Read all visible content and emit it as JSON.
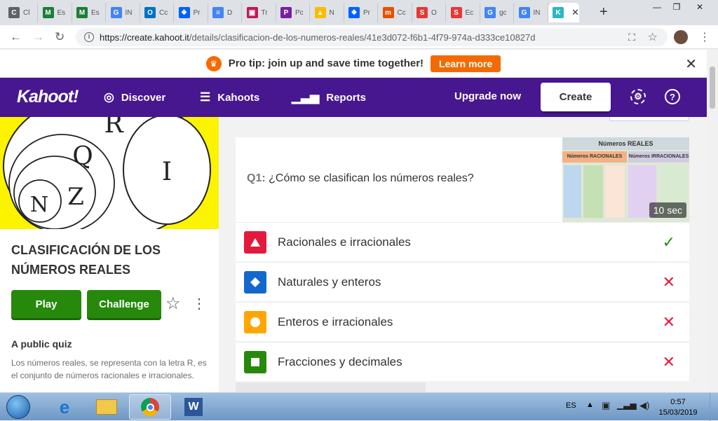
{
  "browser": {
    "tabs": [
      {
        "label": "Cl",
        "color": "#5f6368",
        "glyph": "C"
      },
      {
        "label": "Es",
        "color": "#1a7f37",
        "glyph": "M"
      },
      {
        "label": "Es",
        "color": "#1a7f37",
        "glyph": "M"
      },
      {
        "label": "IN",
        "color": "#4285f4",
        "glyph": "G"
      },
      {
        "label": "Cc",
        "color": "#0072c6",
        "glyph": "O"
      },
      {
        "label": "Pr",
        "color": "#0061fe",
        "glyph": "❖"
      },
      {
        "label": "D",
        "color": "#4285f4",
        "glyph": "≡"
      },
      {
        "label": "Tr",
        "color": "#c2185b",
        "glyph": "▣"
      },
      {
        "label": "Pc",
        "color": "#7b1fa2",
        "glyph": "P"
      },
      {
        "label": "N",
        "color": "#fbbc04",
        "glyph": "▲"
      },
      {
        "label": "Pr",
        "color": "#0061fe",
        "glyph": "❖"
      },
      {
        "label": "Cc",
        "color": "#e65100",
        "glyph": "m"
      },
      {
        "label": "O",
        "color": "#e53935",
        "glyph": "S"
      },
      {
        "label": "Ec",
        "color": "#e53935",
        "glyph": "S"
      },
      {
        "label": "gc",
        "color": "#4285f4",
        "glyph": "G"
      },
      {
        "label": "IN",
        "color": "#4285f4",
        "glyph": "G"
      },
      {
        "label": "",
        "color": "#2db6c6",
        "glyph": "K"
      }
    ],
    "new_tab": "+",
    "window_controls": {
      "min": "—",
      "max": "❐",
      "close": "✕"
    },
    "url_host": "https://create.kahoot.it",
    "url_path": "/details/clasificacion-de-los-numeros-reales/41e3d072-f6b1-4f79-974a-d333ce10827d"
  },
  "promo": {
    "text": "Pro tip: join up and save time together!",
    "button": "Learn more",
    "close": "✕"
  },
  "nav": {
    "logo": "Kahoot!",
    "discover": "Discover",
    "kahoots": "Kahoots",
    "reports": "Reports",
    "upgrade": "Upgrade now",
    "create": "Create"
  },
  "quiz": {
    "cover_letters": {
      "r": "R",
      "q": "Q",
      "i": "I",
      "n": "N",
      "z": "Z"
    },
    "title": "CLASIFICACIÓN DE LOS NÚMEROS REALES",
    "play": "Play",
    "challenge": "Challenge",
    "visibility": "A public quiz",
    "description": "Los números reales, se representa con la letra R, es el conjunto de números racionales e irracionales."
  },
  "question": {
    "number": "Q1:",
    "text": "¿Cómo se clasifican los números reales?",
    "timer": "10 sec",
    "image_title": "Números REALES",
    "image_col1": "Números RACIONALES",
    "image_col2": "Números IRRACIONALES",
    "answers": [
      {
        "text": "Racionales e irracionales",
        "shape": "triangle",
        "color": "#e21b3c",
        "correct": true
      },
      {
        "text": "Naturales y enteros",
        "shape": "diamond",
        "color": "#1368ce",
        "correct": false
      },
      {
        "text": "Enteros e irracionales",
        "shape": "circle",
        "color": "#ffa602",
        "correct": false
      },
      {
        "text": "Fracciones y decimales",
        "shape": "square",
        "color": "#26890c",
        "correct": false
      }
    ]
  },
  "taskbar": {
    "lang": "ES",
    "time": "0:57",
    "date": "15/03/2019"
  }
}
